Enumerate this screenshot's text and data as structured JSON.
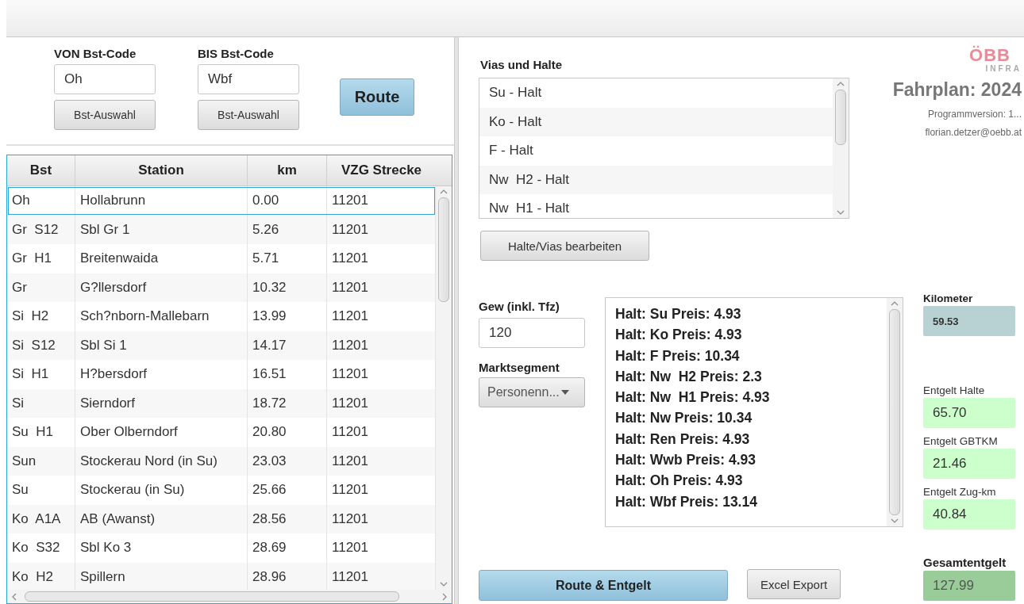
{
  "route_form": {
    "from": {
      "label": "VON Bst-Code",
      "value": "Oh",
      "button": "Bst-Auswahl"
    },
    "to": {
      "label": "BIS Bst-Code",
      "value": "Wbf",
      "button": "Bst-Auswahl"
    },
    "route_button": "Route"
  },
  "table": {
    "columns": [
      "Bst",
      "Station",
      "km",
      "VZG Strecke"
    ],
    "rows": [
      {
        "cells": [
          "Oh",
          "Hollabrunn",
          "0.00",
          "11201"
        ],
        "selected": true
      },
      {
        "cells": [
          "Gr  S12",
          "Sbl Gr 1",
          "5.26",
          "11201"
        ],
        "selected": false
      },
      {
        "cells": [
          "Gr  H1",
          "Breitenwaida",
          "5.71",
          "11201"
        ],
        "selected": false
      },
      {
        "cells": [
          "Gr",
          "G?llersdorf",
          "10.32",
          "11201"
        ],
        "selected": false
      },
      {
        "cells": [
          "Si  H2",
          "Sch?nborn-Mallebarn",
          "13.99",
          "11201"
        ],
        "selected": false
      },
      {
        "cells": [
          "Si  S12",
          "Sbl Si 1",
          "14.17",
          "11201"
        ],
        "selected": false
      },
      {
        "cells": [
          "Si  H1",
          "H?bersdorf",
          "16.51",
          "11201"
        ],
        "selected": false
      },
      {
        "cells": [
          "Si",
          "Sierndorf",
          "18.72",
          "11201"
        ],
        "selected": false
      },
      {
        "cells": [
          "Su  H1",
          "Ober Olberndorf",
          "20.80",
          "11201"
        ],
        "selected": false
      },
      {
        "cells": [
          "Sun",
          "Stockerau Nord (in Su)",
          "23.03",
          "11201"
        ],
        "selected": false
      },
      {
        "cells": [
          "Su",
          "Stockerau (in Su)",
          "25.66",
          "11201"
        ],
        "selected": false
      },
      {
        "cells": [
          "Ko  A1A",
          "AB (Awanst)",
          "28.56",
          "11201"
        ],
        "selected": false
      },
      {
        "cells": [
          "Ko  S32",
          "Sbl Ko 3",
          "28.69",
          "11201"
        ],
        "selected": false
      },
      {
        "cells": [
          "Ko  H2",
          "Spillern",
          "28.96",
          "11201"
        ],
        "selected": false
      }
    ]
  },
  "vias": {
    "title": "Vias und Halte",
    "items": [
      "Su - Halt",
      "Ko - Halt",
      "F - Halt",
      "Nw  H2 - Halt",
      "Nw  H1 - Halt"
    ],
    "edit_button": "Halte/Vias bearbeiten"
  },
  "brand": {
    "logo": "ÖBB",
    "logo_sub": "INFRA",
    "title": "Fahrplan: 2024",
    "version": "Programmversion: 1...",
    "email": "florian.detzer@oebb.at"
  },
  "weight": {
    "label": "Gew (inkl. Tfz)",
    "value": "120"
  },
  "segment": {
    "label": "Marktsegment",
    "value": "Personenn..."
  },
  "results": [
    "Halt: Su Preis: 4.93",
    "Halt: Ko Preis: 4.93",
    "Halt: F Preis: 10.34",
    "Halt: Nw  H2 Preis: 2.3",
    "Halt: Nw  H1 Preis: 4.93",
    "Halt: Nw Preis: 10.34",
    "Halt: Ren Preis: 4.93",
    "Halt: Wwb Preis: 4.93",
    "Halt: Oh Preis: 4.93",
    "Halt: Wbf Preis: 13.14"
  ],
  "fees": [
    {
      "kind": "distance",
      "label": "Kilometer",
      "value": "59.53"
    },
    {
      "kind": "fee",
      "label": "Entgelt Halte",
      "value": "65.70"
    },
    {
      "kind": "fee",
      "label": "Entgelt GBTKM",
      "value": "21.46"
    },
    {
      "kind": "fee",
      "label": "Entgelt Zug-km",
      "value": "40.84"
    }
  ],
  "total": {
    "kind": "total",
    "label": "Gesamtentgelt",
    "value": "127.99"
  },
  "actions": {
    "calculate": "Route & Entgelt",
    "export": "Excel Export"
  }
}
